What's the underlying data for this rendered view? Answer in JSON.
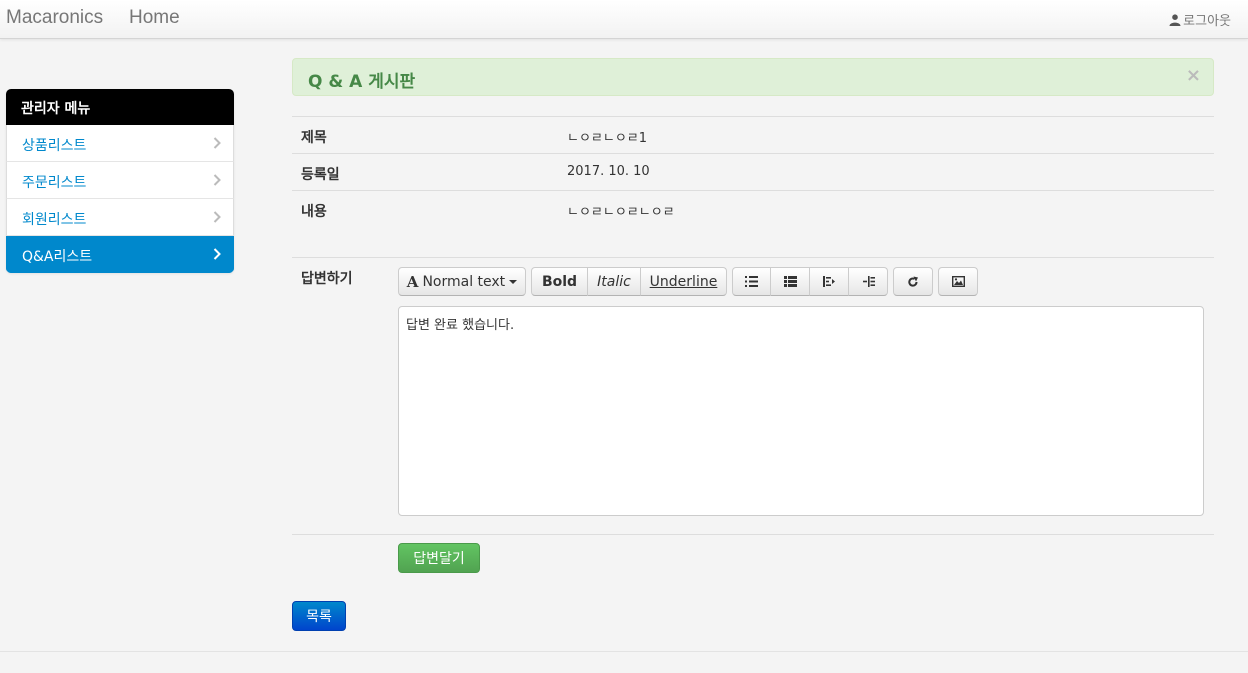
{
  "navbar": {
    "brand": "Macaronics",
    "home": "Home",
    "logout": "로그아웃"
  },
  "sidebar": {
    "header": "관리자 메뉴",
    "items": [
      {
        "label": "상품리스트",
        "active": false
      },
      {
        "label": "주문리스트",
        "active": false
      },
      {
        "label": "회원리스트",
        "active": false
      },
      {
        "label": "Q&A리스트",
        "active": true
      }
    ]
  },
  "board": {
    "title": "Q & A 게시판",
    "close": "×"
  },
  "detail": {
    "title_label": "제목",
    "title_value": "ㄴㅇㄹㄴㅇㄹ1",
    "date_label": "등록일",
    "date_value": "2017. 10. 10",
    "content_label": "내용",
    "content_value": "ㄴㅇㄹㄴㅇㄹㄴㅇㄹ"
  },
  "answer": {
    "label": "답변하기",
    "toolbar": {
      "font_icon": "A",
      "normal_text": "Normal text",
      "bold": "Bold",
      "italic": "Italic",
      "underline": "Underline"
    },
    "editor_text": "답변 완료 했습니다.",
    "submit": "답변달기"
  },
  "list_button": "목록",
  "colors": {
    "accent": "#0088cc",
    "success": "#51a351",
    "alert_bg": "#dff0d8",
    "alert_text": "#468847"
  }
}
